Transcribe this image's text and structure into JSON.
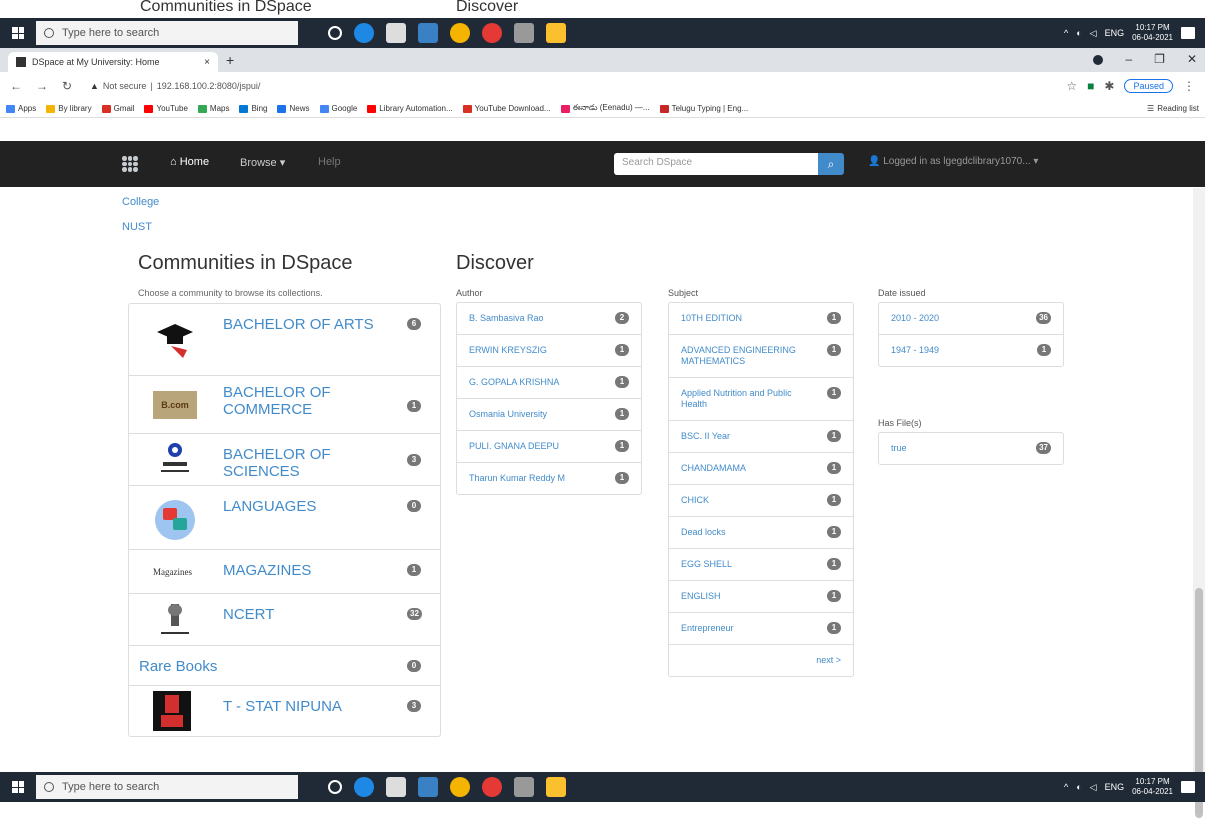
{
  "bleed": {
    "left": "Communities in DSpace",
    "right": "Discover"
  },
  "taskbar": {
    "search_placeholder": "Type here to search",
    "lang": "ENG",
    "time": "10:17 PM",
    "date": "06-04-2021"
  },
  "browser": {
    "tab_title": "DSpace at My University: Home",
    "tab_close": "×",
    "new_tab": "+",
    "security": "Not secure",
    "url": "192.168.100.2:8080/jspui/",
    "paused": "Paused",
    "bookmarks": [
      {
        "label": "Apps",
        "color": "#4285f4"
      },
      {
        "label": "By library",
        "color": "#f4b400"
      },
      {
        "label": "Gmail",
        "color": "#d93025"
      },
      {
        "label": "YouTube",
        "color": "#ff0000"
      },
      {
        "label": "Maps",
        "color": "#34a853"
      },
      {
        "label": "Bing",
        "color": "#0078d4"
      },
      {
        "label": "News",
        "color": "#1a73e8"
      },
      {
        "label": "Google",
        "color": "#4285f4"
      },
      {
        "label": "Library Automation...",
        "color": "#ff0000"
      },
      {
        "label": "YouTube Download...",
        "color": "#d93025"
      },
      {
        "label": "ఈనాడు (Eenadu) —...",
        "color": "#e91e63"
      },
      {
        "label": "Telugu Typing | Eng...",
        "color": "#c62828"
      }
    ],
    "reading_list": "Reading list"
  },
  "navbar": {
    "home": "Home",
    "browse": "Browse",
    "help": "Help",
    "search_placeholder": "Search DSpace",
    "user": "Logged in as lgegdclibrary1070..."
  },
  "top_links": [
    "College",
    "NUST"
  ],
  "communities": {
    "heading": "Communities in DSpace",
    "subheading": "Choose a community to browse its collections.",
    "items": [
      {
        "name": "BACHELOR OF ARTS",
        "count": "6",
        "logo": "graduation-cap-logo"
      },
      {
        "name": "BACHELOR OF COMMERCE",
        "count": "1",
        "logo": "bcom-logo"
      },
      {
        "name": "BACHELOR OF SCIENCES",
        "count": "3",
        "logo": "bsc-logo"
      },
      {
        "name": "LANGUAGES",
        "count": "0",
        "logo": "languages-logo"
      },
      {
        "name": "MAGAZINES",
        "count": "1",
        "logo": "magazines-logo",
        "logo_text": "Magazines"
      },
      {
        "name": "NCERT",
        "count": "32",
        "logo": "ncert-logo"
      },
      {
        "name": "Rare Books",
        "count": "0",
        "logo": ""
      },
      {
        "name": "T - STAT NIPUNA",
        "count": "3",
        "logo": "tstat-logo"
      }
    ]
  },
  "discover": {
    "heading": "Discover",
    "author": {
      "label": "Author",
      "items": [
        {
          "name": "B. Sambasiva Rao",
          "count": "2"
        },
        {
          "name": "ERWIN KREYSZIG",
          "count": "1"
        },
        {
          "name": "G. GOPALA KRISHNA",
          "count": "1"
        },
        {
          "name": "Osmania University",
          "count": "1"
        },
        {
          "name": "PULI. GNANA DEEPU",
          "count": "1"
        },
        {
          "name": "Tharun Kumar Reddy M",
          "count": "1"
        }
      ]
    },
    "subject": {
      "label": "Subject",
      "items": [
        {
          "name": "10TH EDITION",
          "count": "1"
        },
        {
          "name": "ADVANCED ENGINEERING MATHEMATICS",
          "count": "1"
        },
        {
          "name": "Applied Nutrition and Public Health",
          "count": "1"
        },
        {
          "name": "BSC. II Year",
          "count": "1"
        },
        {
          "name": "CHANDAMAMA",
          "count": "1"
        },
        {
          "name": "CHICK",
          "count": "1"
        },
        {
          "name": "Dead locks",
          "count": "1"
        },
        {
          "name": "EGG SHELL",
          "count": "1"
        },
        {
          "name": "ENGLISH",
          "count": "1"
        },
        {
          "name": "Entrepreneur",
          "count": "1"
        }
      ],
      "next": "next >"
    },
    "date": {
      "label": "Date issued",
      "items": [
        {
          "name": "2010 - 2020",
          "count": "36"
        },
        {
          "name": "1947 - 1949",
          "count": "1"
        }
      ]
    },
    "files": {
      "label": "Has File(s)",
      "items": [
        {
          "name": "true",
          "count": "37"
        }
      ]
    }
  }
}
